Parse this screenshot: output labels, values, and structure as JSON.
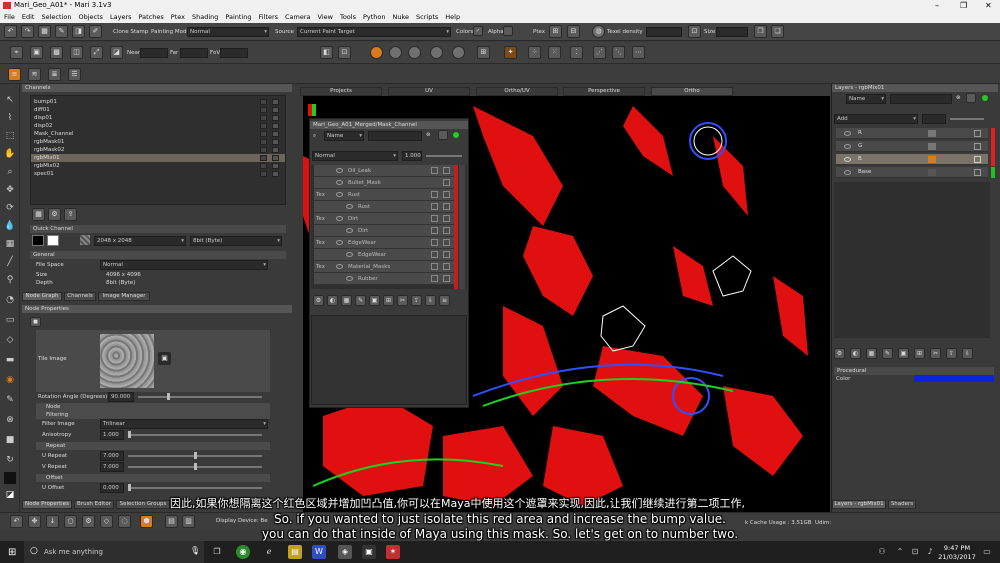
{
  "window": {
    "title": "Mari_Geo_A01* - Mari 3.1v3",
    "minimize": "–",
    "maximize": "❐",
    "close": "✕"
  },
  "menu": [
    "File",
    "Edit",
    "Selection",
    "Objects",
    "Layers",
    "Patches",
    "Ptex",
    "Shading",
    "Painting",
    "Filters",
    "Camera",
    "View",
    "Tools",
    "Python",
    "Nuke",
    "Scripts",
    "Help"
  ],
  "toolbar1": {
    "clone_stamp": "Clone Stamp",
    "painting_mode_label": "Painting Mode",
    "painting_mode_value": "Normal",
    "source_label": "Source",
    "source_value": "Current Paint Target",
    "colors_label": "Colors",
    "alpha_label": "Alpha",
    "ptex_label": "Ptex",
    "texel_label": "Texel density",
    "size_label": "Size"
  },
  "toolbar2": {
    "near_label": "Near",
    "far_label": "Far",
    "fov_label": "FoV"
  },
  "channels": {
    "title": "Channels",
    "items": [
      "bump01",
      "diff01",
      "disp01",
      "disp02",
      "Mask_Channel",
      "rgbMask01",
      "rgbMask02",
      "rgbMix01",
      "rgbMix02",
      "spec01"
    ],
    "selected_index": 7
  },
  "quick_channel": {
    "title": "Quick Channel",
    "resolution": "2048 x 2048",
    "depth": "8bit (Byte)"
  },
  "general": {
    "title": "General",
    "file_space_label": "File Space",
    "file_space_value": "Normal",
    "size_label": "Size",
    "size_value": "4096 x 4096",
    "depth_label": "Depth",
    "depth_value": "8bit (Byte)"
  },
  "left_tabs": [
    "Node Graph",
    "Channels",
    "Image Manager"
  ],
  "node_properties": {
    "title": "Node Properties",
    "tile_image_label": "Tile Image",
    "rotation_label": "Rotation Angle (Degrees)",
    "rotation_value": "90.000",
    "node_section": "Node",
    "filtering_section": "Filtering",
    "filter_image_label": "Filter Image",
    "filter_image_value": "Trilinear",
    "anisotropy_label": "Anisotropy",
    "anisotropy_value": "1.000",
    "repeat_section": "Repeat",
    "u_repeat_label": "U Repeat",
    "u_repeat_value": "7.000",
    "v_repeat_label": "V Repeat",
    "v_repeat_value": "7.000",
    "offset_section": "Offset",
    "u_offset_label": "U Offset",
    "u_offset_value": "0.000"
  },
  "bottom_tabs": [
    "Node Properties",
    "Brush Editor",
    "Selection Groups"
  ],
  "display_device": "Display Device: Be",
  "viewport_tabs": [
    "Projects",
    "UV",
    "Ortho/UV",
    "Perspective",
    "Ortho"
  ],
  "viewport_active_tab": 4,
  "float_window": {
    "title": "Mari_Geo_A01_Merged/Mask_Channel",
    "name_label": "Name",
    "blend_mode": "Normal",
    "opacity": "1.000",
    "layers": [
      "Oil_Leak",
      "Bullet_Mask",
      "Rust",
      "Rust",
      "Dirt",
      "Dirt",
      "EdgeWear",
      "EdgeWear",
      "Material_Masks",
      "Rubber"
    ],
    "tags": [
      "",
      "",
      "Tex",
      "",
      "Tex",
      "",
      "Tex",
      "",
      "Tex",
      ""
    ]
  },
  "layers_panel": {
    "title": "Layers - rgbMix01",
    "name_label": "Name",
    "blend_mode": "Add",
    "rows": [
      "R",
      "G",
      "B",
      "Base"
    ],
    "selected_index": 2,
    "row_colors": [
      "#e02020",
      "#e02020",
      "#e02020",
      "#20c020"
    ]
  },
  "procedural": {
    "title": "Procedural",
    "color_label": "Color",
    "color_value": "#1020e0"
  },
  "right_tabs": [
    "Layers - rgbMix01",
    "Shaders"
  ],
  "status": {
    "cache_label": "k Cache Usage : 3.51GB",
    "udim_label": "Udim:"
  },
  "subtitles": {
    "chinese": "因此,如果你想隔离这个红色区域并增加凹凸值,你可以在Maya中使用这个遮罩来实现,因此,让我们继续进行第二项工作,",
    "english_1": "So. if you wanted to just isolate this red area and increase the bump value.",
    "english_2": "you can do that inside of Maya using this mask. So. let's get on to number two."
  },
  "taskbar": {
    "search_placeholder": "Ask me anything",
    "time": "9:47 PM",
    "date": "21/03/2017"
  },
  "accent_color": "#d97a1c"
}
